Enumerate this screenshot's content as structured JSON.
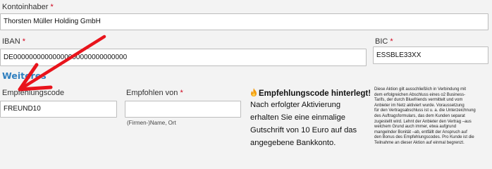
{
  "form": {
    "account_holder": {
      "label": "Kontoinhaber",
      "required_mark": "*",
      "value": "Thorsten Müller Holding GmbH"
    },
    "iban": {
      "label": "IBAN",
      "required_mark": "*",
      "value": "DE00000000000000000000000000000"
    },
    "bic": {
      "label": "BIC",
      "required_mark": "*",
      "value": "ESSBLE33XX"
    },
    "section_title": "Weiteres",
    "referral_code": {
      "label": "Empfehlungscode",
      "value": "FREUND10"
    },
    "referred_by": {
      "label": "Empfohlen von",
      "required_mark": "*",
      "value": "",
      "hint": "(Firmen-)Name, Ort"
    }
  },
  "promo": {
    "icon": "fire-emoji",
    "title": "Empfehlungscode hinterlegt!",
    "lines": [
      "Nach erfolgter Aktivierung",
      "erhalten Sie eine einmalige",
      "Gutschrift von 10 Euro auf das",
      "angegebene Bankkonto."
    ]
  },
  "fine_print": {
    "lines": [
      "Diese Aktion gilt ausschließlich in Verbindung mit",
      "dem erfolgreichen Abschluss eines o2 Business-",
      "Tarifs, der durch Bluefriends vermittelt und vom",
      "Anbieter im Netz aktiviert wurde. Voraussetzung",
      "für den Vertragsabschluss ist u. a. die Unterzeichnung",
      "des Auftragsformulars, das dem Kunden separat",
      "zugestellt wird. Lehnt der Anbieter den Vertrag –aus",
      "welchem Grund auch immer, etwa aufgrund",
      "mangelnder Bonität –ab, entfällt der Anspruch auf",
      "den Bonus des Empfehlungscodes. Pro Kunde ist die",
      "Teilnahme an dieser Aktion auf einmal begrenzt."
    ]
  },
  "colors": {
    "background": "#f3f3f3",
    "required": "#d0021b",
    "section_title": "#2f7fbf",
    "arrow": "#e8141c"
  }
}
